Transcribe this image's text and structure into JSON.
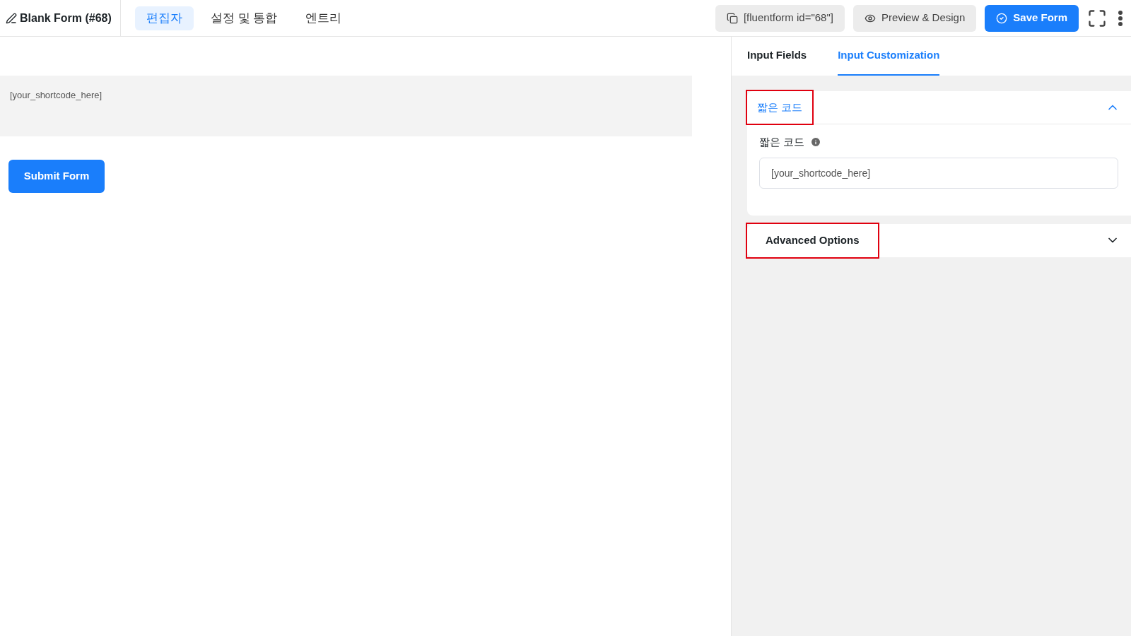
{
  "header": {
    "title": "Blank Form (#68)",
    "nav": [
      {
        "label": "편집자",
        "selected": true
      },
      {
        "label": "설정 및 통합",
        "selected": false
      },
      {
        "label": "엔트리",
        "selected": false
      }
    ],
    "shortcode": "[fluentform id=\"68\"]",
    "preview_button": "Preview & Design",
    "save_button": "Save Form"
  },
  "canvas": {
    "shortcode_block": "[your_shortcode_here]",
    "submit_button": "Submit Form"
  },
  "panel": {
    "tabs": [
      {
        "label": "Input Fields",
        "selected": false
      },
      {
        "label": "Input Customization",
        "selected": true
      }
    ],
    "sections": [
      {
        "title": "짧은 코드",
        "expanded": true,
        "highlighted": true,
        "field_label": "짧은 코드",
        "field_value": "[your_shortcode_here]"
      },
      {
        "title": "Advanced Options",
        "expanded": false,
        "highlighted": true
      }
    ]
  }
}
